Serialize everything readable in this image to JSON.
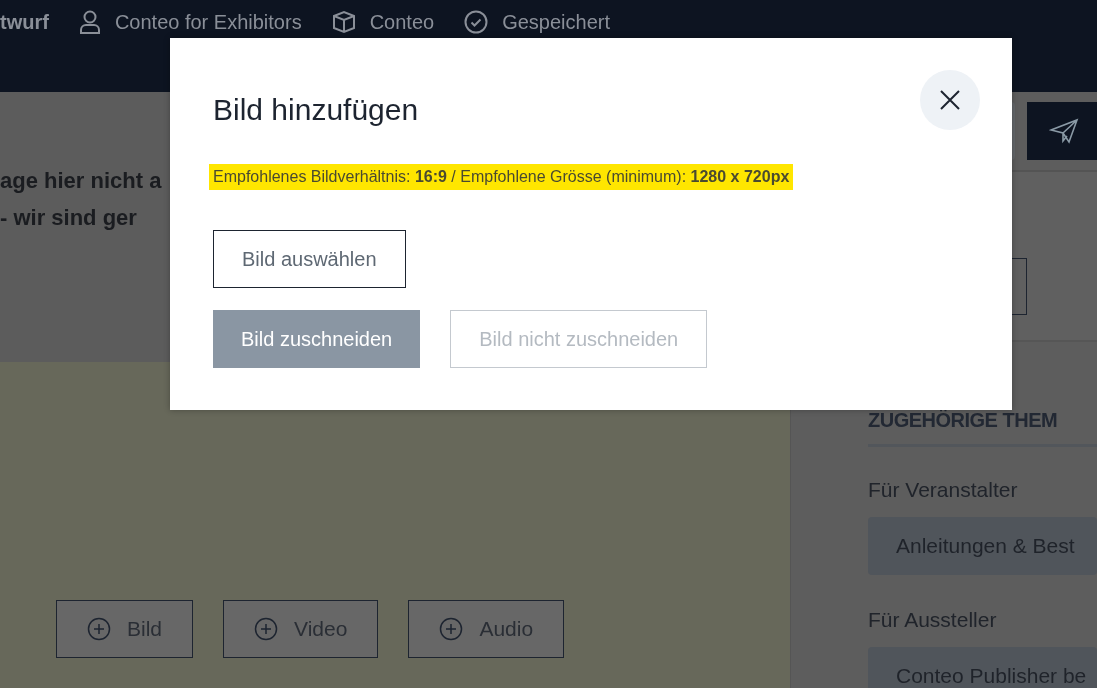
{
  "top_bar": {
    "status": "twurf",
    "items": [
      {
        "kind": "user",
        "label": "Conteo for Exhibitors"
      },
      {
        "kind": "box",
        "label": "Conteo"
      },
      {
        "kind": "check",
        "label": "Gespeichert"
      }
    ]
  },
  "content": {
    "lines": [
      "age hier nicht a",
      "- wir sind ger"
    ],
    "add_buttons": [
      {
        "label": "Bild"
      },
      {
        "label": "Video"
      },
      {
        "label": "Audio"
      }
    ]
  },
  "sidebar": {
    "heading": "ZUGEHÖRIGE THEM",
    "groups": [
      {
        "label": "Für Veranstalter",
        "chip": "Anleitungen & Best"
      },
      {
        "label": "Für Aussteller",
        "chip": "Conteo Publisher be"
      }
    ]
  },
  "dialog": {
    "title": "Bild hinzufügen",
    "hint": "Empfohlenes Bildverhältnis: **16:9** / Empfohlene Grösse (minimum): **1280 x 720px**",
    "select_button": "Bild auswählen",
    "buttons": [
      {
        "label": "Bild zuschneiden",
        "primary": true,
        "disabled": false
      },
      {
        "label": "Bild nicht zuschneiden",
        "primary": false,
        "disabled": true
      }
    ]
  }
}
